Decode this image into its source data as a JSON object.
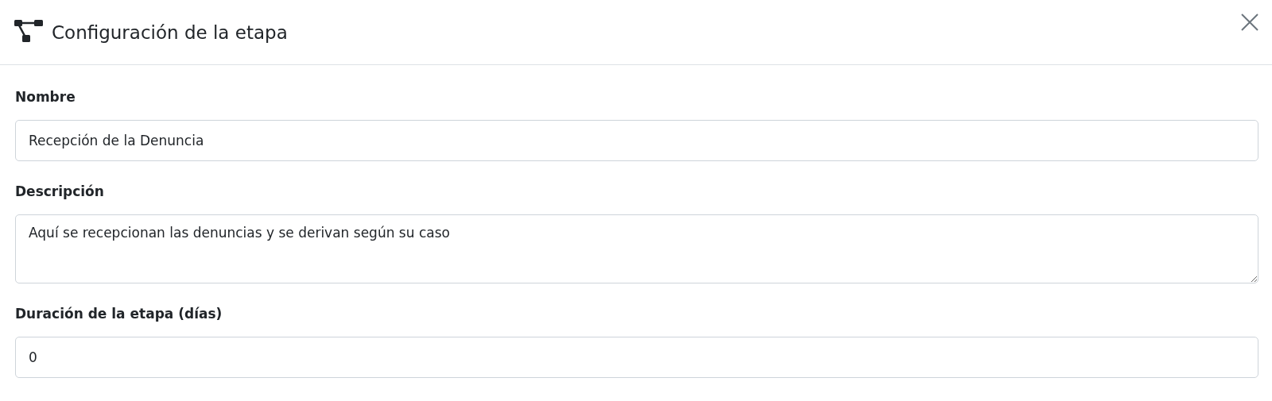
{
  "dialog": {
    "title": "Configuración de la etapa"
  },
  "fields": [
    {
      "label": "Nombre",
      "kind": "input",
      "value": "Recepción de la Denuncia"
    },
    {
      "label": "Descripción",
      "kind": "textarea",
      "value": "Aquí se recepcionan las denuncias y se derivan según su caso"
    },
    {
      "label": "Duración de la etapa (días)",
      "kind": "input",
      "value": "0"
    }
  ]
}
